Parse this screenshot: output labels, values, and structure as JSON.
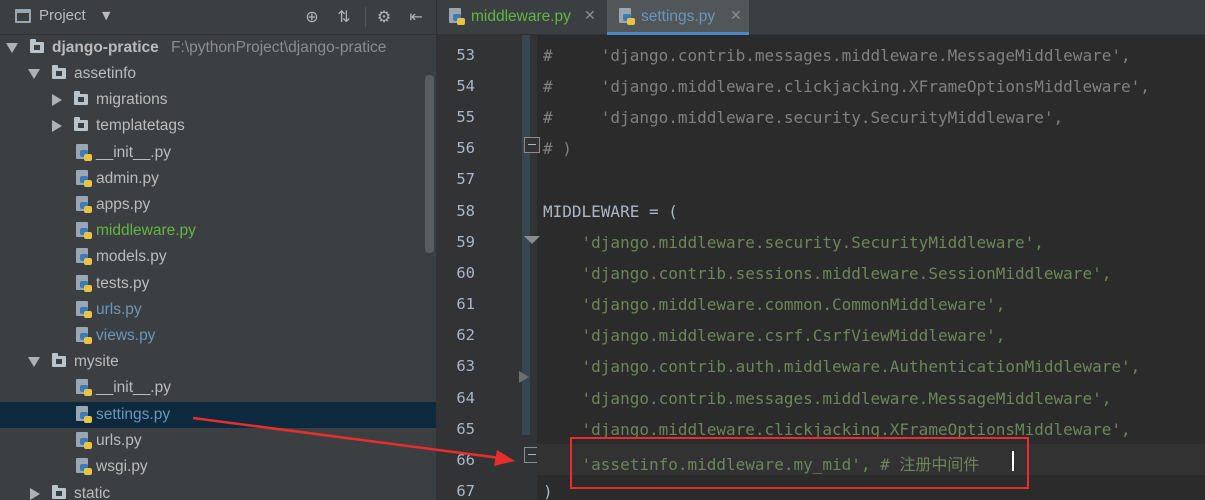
{
  "project_panel": {
    "title": "Project",
    "tree": [
      {
        "label": "django-pratice",
        "path": "F:\\pythonProject\\django-pratice",
        "kind": "root"
      },
      {
        "label": "assetinfo",
        "kind": "folder-open"
      },
      {
        "label": "migrations",
        "kind": "folder-closed"
      },
      {
        "label": "templatetags",
        "kind": "folder-closed"
      },
      {
        "label": "__init__.py",
        "kind": "py"
      },
      {
        "label": "admin.py",
        "kind": "py"
      },
      {
        "label": "apps.py",
        "kind": "py"
      },
      {
        "label": "middleware.py",
        "kind": "py-new"
      },
      {
        "label": "models.py",
        "kind": "py"
      },
      {
        "label": "tests.py",
        "kind": "py"
      },
      {
        "label": "urls.py",
        "kind": "py-modified"
      },
      {
        "label": "views.py",
        "kind": "py-modified"
      },
      {
        "label": "mysite",
        "kind": "folder-open"
      },
      {
        "label": "__init__.py",
        "kind": "py"
      },
      {
        "label": "settings.py",
        "kind": "py-modified-selected"
      },
      {
        "label": "urls.py",
        "kind": "py"
      },
      {
        "label": "wsgi.py",
        "kind": "py"
      },
      {
        "label": "static",
        "kind": "folder-closed"
      }
    ]
  },
  "editor": {
    "tabs": [
      {
        "label": "middleware.py",
        "active": false
      },
      {
        "label": "settings.py",
        "active": true
      }
    ],
    "lines": [
      {
        "num": "53",
        "text": "#     'django.contrib.messages.middleware.MessageMiddleware',"
      },
      {
        "num": "54",
        "text": "#     'django.middleware.clickjacking.XFrameOptionsMiddleware',"
      },
      {
        "num": "55",
        "text": "#     'django.middleware.security.SecurityMiddleware',"
      },
      {
        "num": "56",
        "text": "# )"
      },
      {
        "num": "57",
        "text": ""
      },
      {
        "num": "58",
        "text": "MIDDLEWARE = ("
      },
      {
        "num": "59",
        "text": "    'django.middleware.security.SecurityMiddleware',"
      },
      {
        "num": "60",
        "text": "    'django.contrib.sessions.middleware.SessionMiddleware',"
      },
      {
        "num": "61",
        "text": "    'django.middleware.common.CommonMiddleware',"
      },
      {
        "num": "62",
        "text": "    'django.middleware.csrf.CsrfViewMiddleware',"
      },
      {
        "num": "63",
        "text": "    'django.contrib.auth.middleware.AuthenticationMiddleware',"
      },
      {
        "num": "64",
        "text": "    'django.contrib.messages.middleware.MessageMiddleware',"
      },
      {
        "num": "65",
        "text": "    'django.middleware.clickjacking.XFrameOptionsMiddleware',"
      },
      {
        "num": "66",
        "text": "    'assetinfo.middleware.my_mid', # 注册中间件"
      },
      {
        "num": "67",
        "text": ")"
      }
    ],
    "current_line": "66"
  },
  "colors": {
    "comment": "#808080",
    "string": "#6a8759",
    "keyword": "#cc7832",
    "annotation_red": "#e82d2d",
    "new_file_green": "#62b543",
    "modified_blue": "#6897bb"
  }
}
